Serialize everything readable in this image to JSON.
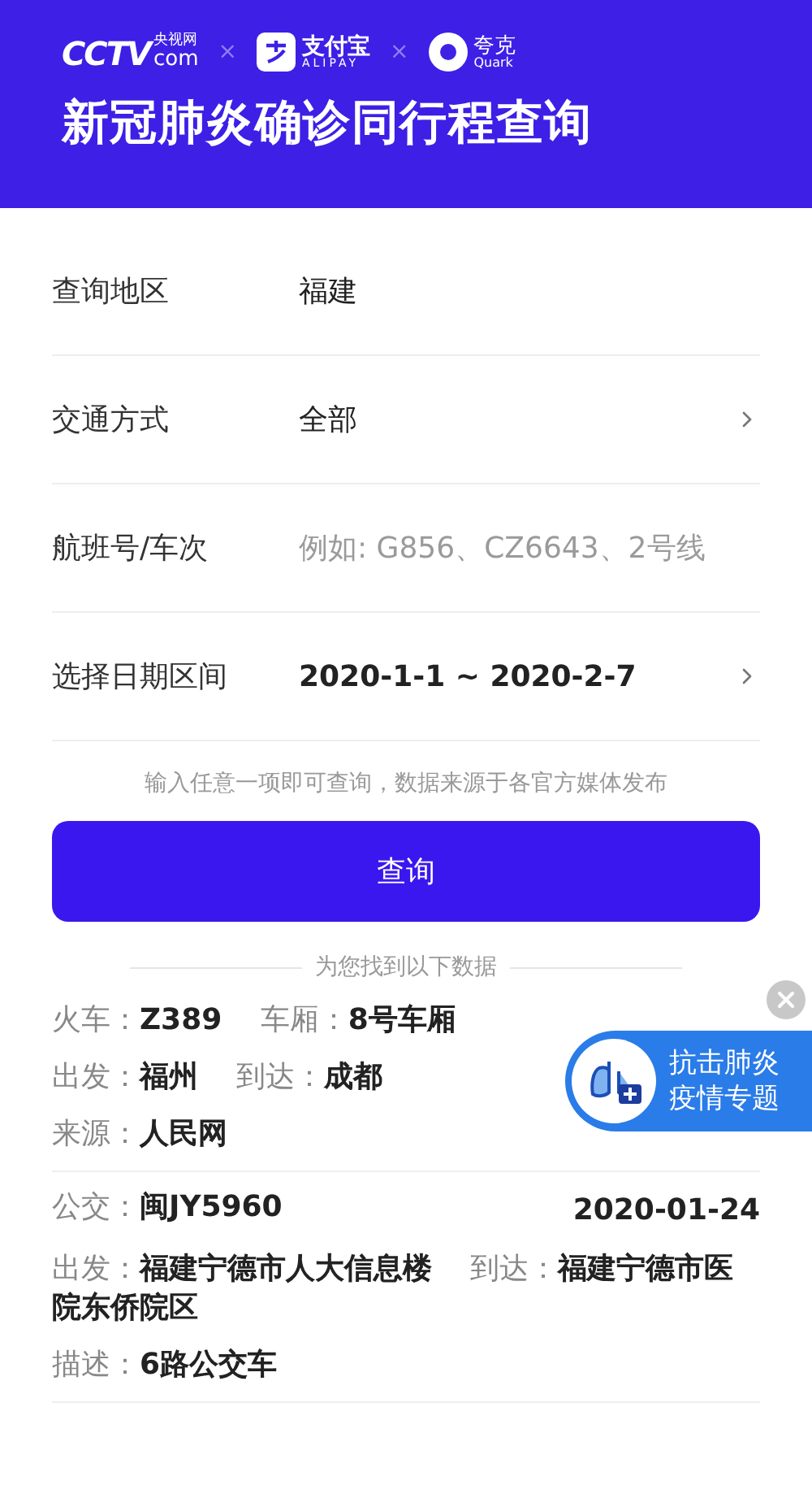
{
  "header": {
    "logos": [
      {
        "kind": "cctv",
        "name": "CCTV",
        "suffix": "com",
        "sub": "央视网"
      },
      {
        "kind": "alipay",
        "name": "支付宝",
        "sub": "ALIPAY"
      },
      {
        "kind": "quark",
        "name": "夸克",
        "sub": "Quark"
      }
    ],
    "separator": "×",
    "title": "新冠肺炎确诊同行程查询"
  },
  "form": [
    {
      "kind": "text",
      "label": "查询地区",
      "value": "福建"
    },
    {
      "kind": "select",
      "label": "交通方式",
      "value": "全部"
    },
    {
      "kind": "input",
      "label": "航班号/车次",
      "placeholder": "例如: G856、CZ6643、2号线"
    },
    {
      "kind": "select",
      "label": "选择日期区间",
      "value": "2020-1-1 ~ 2020-2-7",
      "bold": true
    }
  ],
  "hint": "输入任意一项即可查询，数据来源于各官方媒体发布",
  "button": "查询",
  "results_title": "为您找到以下数据",
  "results": [
    {
      "lines": [
        [
          {
            "label": "火车：",
            "value": "Z389"
          },
          {
            "label": "车厢：",
            "value": "8号车厢"
          }
        ],
        [
          {
            "label": "出发：",
            "value": "福州"
          },
          {
            "label": "到达：",
            "value": "成都"
          }
        ],
        [
          {
            "label": "来源：",
            "value": "人民网"
          }
        ]
      ]
    },
    {
      "date": "2020-01-24",
      "lines": [
        [
          {
            "label": "公交：",
            "value": "闽JY5960"
          }
        ],
        [
          {
            "label": "出发：",
            "value": "福建宁德市人大信息楼"
          },
          {
            "label": "到达：",
            "value": "福建宁德市医院东侨院区"
          }
        ],
        [
          {
            "label": "描述：",
            "value": "6路公交车"
          }
        ]
      ]
    }
  ],
  "float_badge": {
    "lines": [
      "抗击肺炎",
      "疫情专题"
    ]
  }
}
